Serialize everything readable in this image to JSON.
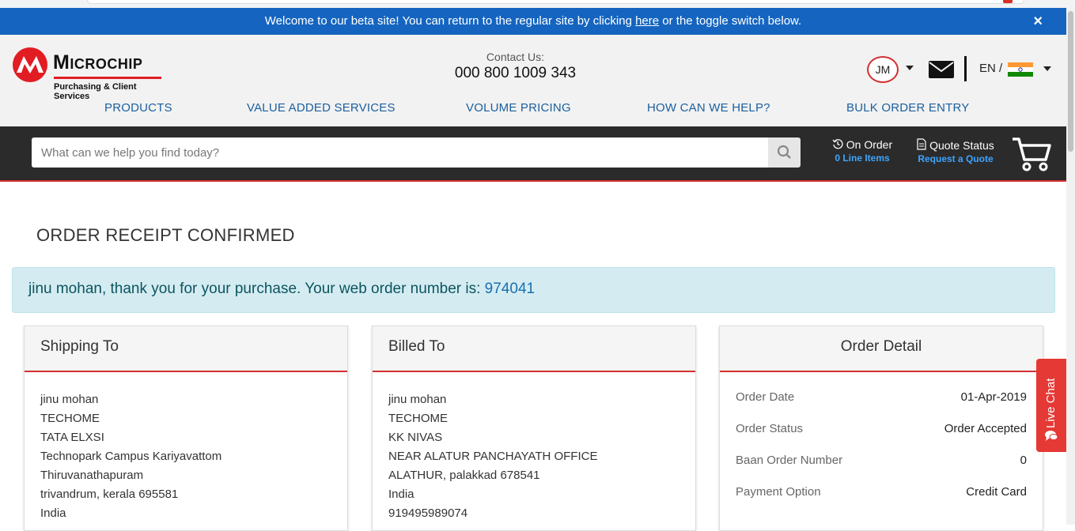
{
  "beta_banner": {
    "text_before": "Welcome to our beta site! You can return to the regular site by clicking ",
    "link": "here",
    "text_after": " or the toggle switch below.",
    "close": "×"
  },
  "header": {
    "logo_word": "Microchip",
    "logo_sub": "Purchasing & Client Services",
    "contact_label": "Contact Us:",
    "contact_number": "000 800 1009 343",
    "avatar_initials": "JM",
    "language": "EN /"
  },
  "nav": [
    "PRODUCTS",
    "VALUE ADDED SERVICES",
    "VOLUME PRICING",
    "HOW CAN WE HELP?",
    "BULK ORDER ENTRY"
  ],
  "search": {
    "placeholder": "What can we help you find today?",
    "on_order_label": "On Order",
    "on_order_sub": "0 Line Items",
    "quote_label": "Quote Status",
    "quote_sub": "Request a Quote"
  },
  "page_title": "ORDER RECEIPT CONFIRMED",
  "alert": {
    "text": "jinu mohan, thank you for your purchase. Your web order number is: ",
    "order_number": "974041"
  },
  "shipping": {
    "title": "Shipping To",
    "lines": [
      "jinu mohan",
      "TECHOME",
      "TATA ELXSI",
      "Technopark Campus Kariyavattom",
      "Thiruvanathapuram",
      "trivandrum, kerala 695581",
      "India"
    ]
  },
  "billing": {
    "title": "Billed To",
    "lines": [
      "jinu mohan",
      "TECHOME",
      "KK NIVAS",
      "NEAR ALATUR PANCHAYATH OFFICE",
      "ALATHUR, palakkad 678541",
      "India",
      "919495989074"
    ]
  },
  "order_detail": {
    "title": "Order Detail",
    "rows": [
      {
        "label": "Order Date",
        "value": "01-Apr-2019"
      },
      {
        "label": "Order Status",
        "value": "Order Accepted"
      },
      {
        "label": "Baan Order Number",
        "value": "0"
      },
      {
        "label": "Payment Option",
        "value": "Credit Card"
      }
    ]
  },
  "live_chat": "Live Chat",
  "colors": {
    "brand_red": "#d32f2f",
    "banner_blue": "#1565c0",
    "nav_blue": "#1a5f9e",
    "dark_bar": "#2b2b2b",
    "alert_bg": "#d4ecf1"
  }
}
